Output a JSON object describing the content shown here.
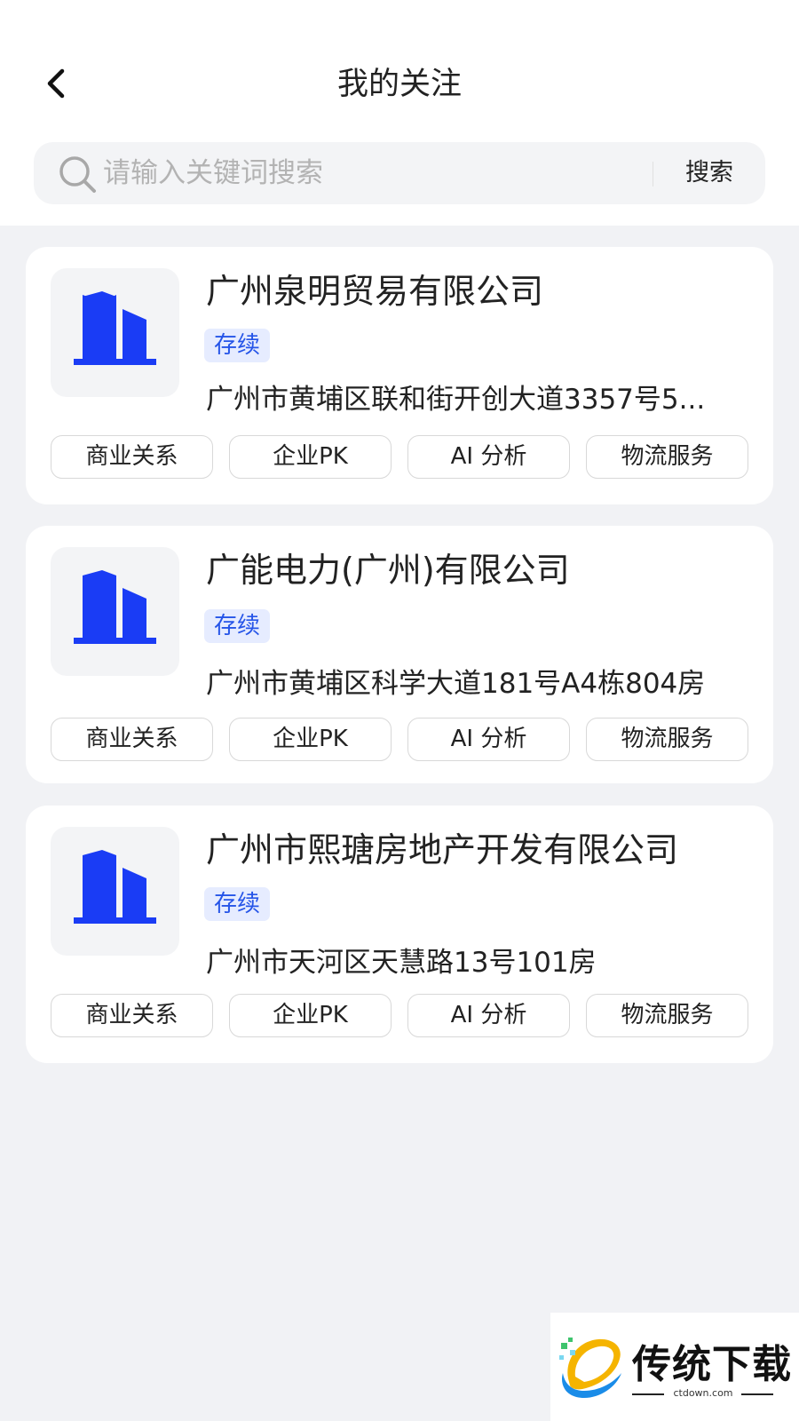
{
  "header": {
    "title": "我的关注"
  },
  "search": {
    "placeholder": "请输入关键词搜索",
    "value": "",
    "button_label": "搜索"
  },
  "companies": [
    {
      "name": "广州泉明贸易有限公司",
      "status": "存续",
      "address": "广州市黄埔区联和街开创大道3357号5...",
      "actions": [
        "商业关系",
        "企业PK",
        "AI 分析",
        "物流服务"
      ]
    },
    {
      "name": "广能电力(广州)有限公司",
      "status": "存续",
      "address": "广州市黄埔区科学大道181号A4栋804房",
      "actions": [
        "商业关系",
        "企业PK",
        "AI 分析",
        "物流服务"
      ]
    },
    {
      "name": "广州市熙瑭房地产开发有限公司",
      "status": "存续",
      "address": "广州市天河区天慧路13号101房",
      "actions": [
        "商业关系",
        "企业PK",
        "AI 分析",
        "物流服务"
      ]
    }
  ],
  "watermark": {
    "brand": "传统下载",
    "url": "ctdown.com"
  },
  "icons": {
    "back": "chevron-left-icon",
    "search": "search-icon",
    "company_logo": "building-icon"
  },
  "colors": {
    "accent": "#1a3cf5",
    "badge_bg": "#e6ecff",
    "badge_text": "#2655e8",
    "page_bg": "#f1f2f5"
  }
}
